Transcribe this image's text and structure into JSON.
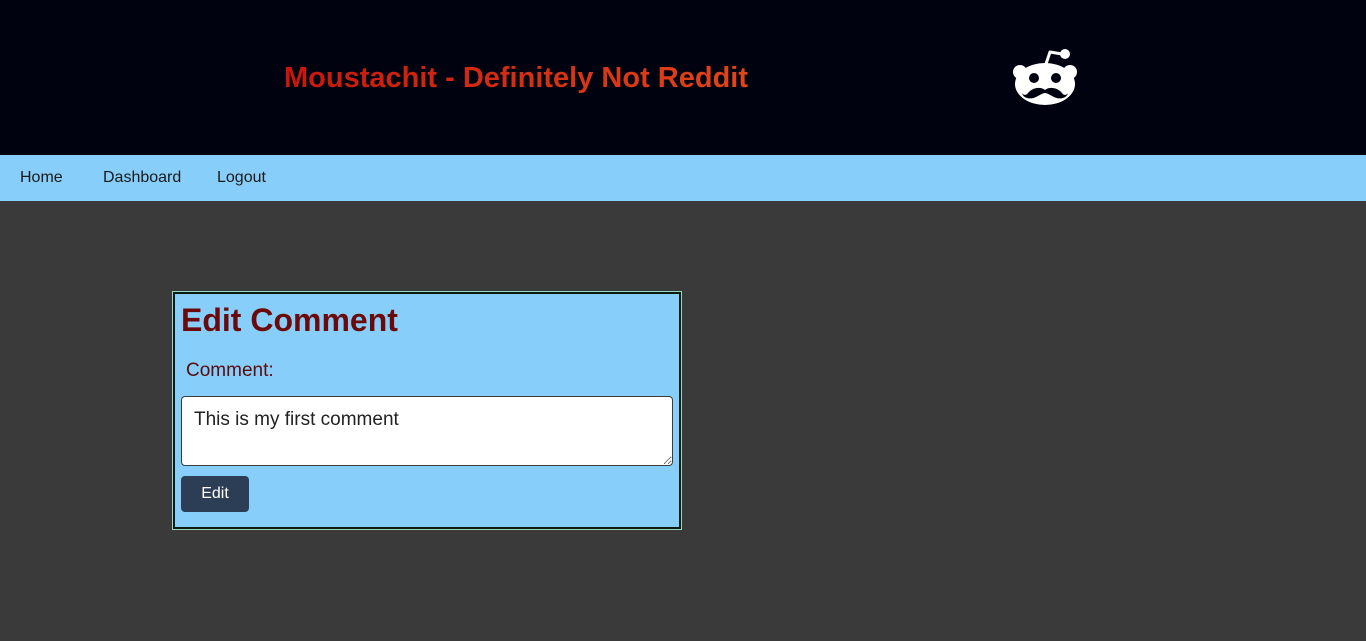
{
  "header": {
    "title": "Moustachit - Definitely Not Reddit",
    "logo_icon": "reddit-alien-moustache-icon",
    "background_color": "#01020f",
    "title_colors": [
      "#c8160e",
      "#e0451a"
    ]
  },
  "nav": {
    "background_color": "#87cefa",
    "items": [
      {
        "label": "Home"
      },
      {
        "label": "Dashboard"
      },
      {
        "label": "Logout"
      }
    ]
  },
  "edit_form": {
    "title": "Edit Comment",
    "comment_label": "Comment:",
    "comment_value": "This is my first comment",
    "submit_label": "Edit",
    "background_color": "#87cefa",
    "title_color": "#6b0a0a",
    "button_color": "#2c3e55"
  },
  "page": {
    "background_color": "#3a3a3a"
  }
}
